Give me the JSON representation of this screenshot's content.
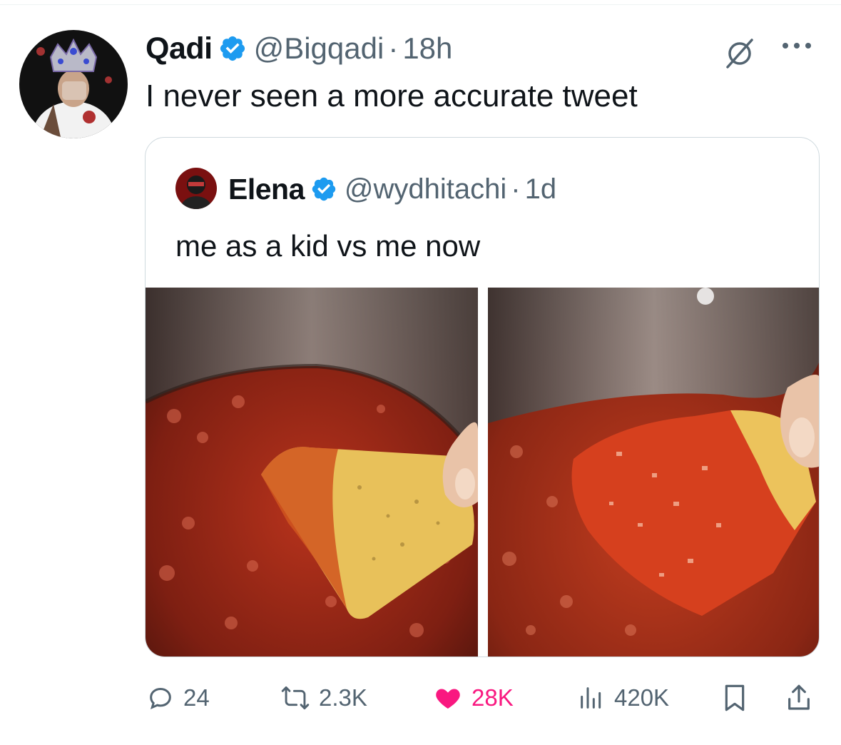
{
  "tweet": {
    "author_name": "Qadi",
    "handle": "@Bigqadi",
    "separator": "·",
    "time": "18h",
    "text": "I never seen a more accurate tweet"
  },
  "quoted": {
    "author_name": "Elena",
    "handle": "@wydhitachi",
    "separator": "·",
    "time": "1d",
    "text": "me as a kid vs me now"
  },
  "actions": {
    "replies": "24",
    "reposts": "2.3K",
    "likes": "28K",
    "views": "420K"
  },
  "colors": {
    "verified": "#1d9bf0",
    "like": "#f91880",
    "secondary_text": "#536471"
  },
  "icons": [
    "verified-badge-icon",
    "grok-icon",
    "more-icon",
    "reply-icon",
    "repost-icon",
    "heart-icon",
    "views-icon",
    "bookmark-icon",
    "share-icon"
  ]
}
